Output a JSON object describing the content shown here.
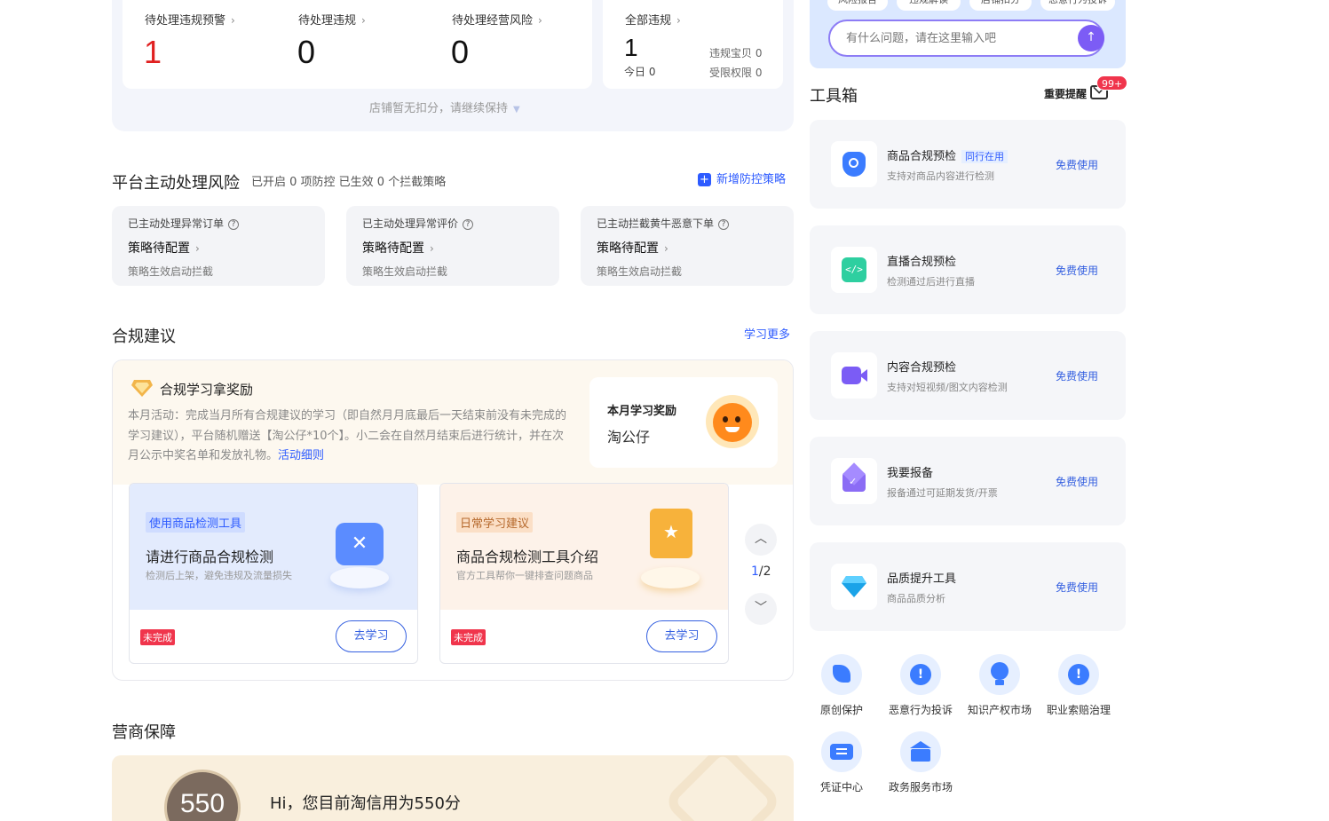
{
  "summary": {
    "items": [
      {
        "label": "待处理违规预警",
        "value": "1"
      },
      {
        "label": "待处理违规",
        "value": "0"
      },
      {
        "label": "待处理经营风险",
        "value": "0"
      }
    ],
    "all": {
      "label": "全部违规",
      "value": "1",
      "today": "今日 0",
      "baobei": "违规宝贝 0",
      "restrict": "受限权限 0"
    },
    "hint": "店铺暂无扣分，请继续保持"
  },
  "risk": {
    "title": "平台主动处理风险",
    "status": "已开启 0 项防控 已生效 0 个拦截策略",
    "add_label": "新增防控策略",
    "cards": [
      {
        "title": "已主动处理异常订单",
        "status": "策略待配置",
        "desc": "策略生效启动拦截"
      },
      {
        "title": "已主动处理异常评价",
        "status": "策略待配置",
        "desc": "策略生效启动拦截"
      },
      {
        "title": "已主动拦截黄牛恶意下单",
        "status": "策略待配置",
        "desc": "策略生效启动拦截"
      }
    ]
  },
  "compliance": {
    "title": "合规建议",
    "more": "学习更多",
    "promo_title": "合规学习拿奖励",
    "promo_text": "本月活动：完成当月所有合规建议的学习（即自然月月底最后一天结束前没有未完成的学习建议），平台随机赠送【淘公仔*10个】。小二会在自然月结束后进行统计，并在次月公示中奖名单和发放礼物。",
    "promo_link": "活动细则",
    "reward_title": "本月学习奖励",
    "reward_item": "淘公仔",
    "cards": [
      {
        "tag": "使用商品检测工具",
        "title": "请进行商品合规检测",
        "sub": "检测后上架，避免违规及流量损失",
        "badge": "未完成",
        "button": "去学习"
      },
      {
        "tag": "日常学习建议",
        "title": "商品合规检测工具介绍",
        "sub": "官方工具帮你一键排查问题商品",
        "badge": "未完成",
        "button": "去学习"
      }
    ],
    "pager_current": "1",
    "pager_total": "/2"
  },
  "guarantee": {
    "title": "营商保障",
    "score": "550",
    "text": "Hi，您目前淘信用为550分"
  },
  "ai": {
    "chips": [
      "风险报告",
      "违规解读",
      "店铺扣分",
      "恶意行为投诉"
    ],
    "placeholder": "有什么问题，请在这里输入吧"
  },
  "toolbox": {
    "title": "工具箱",
    "reminder": "重要提醒",
    "reminder_badge": "99+",
    "tools": [
      {
        "name": "商品合规预检",
        "tag": "同行在用",
        "desc": "支持对商品内容进行检测",
        "action": "免费使用"
      },
      {
        "name": "直播合规预检",
        "desc": "检测通过后进行直播",
        "action": "免费使用"
      },
      {
        "name": "内容合规预检",
        "desc": "支持对短视频/图文内容检测",
        "action": "免费使用"
      },
      {
        "name": "我要报备",
        "desc": "报备通过可延期发货/开票",
        "action": "免费使用"
      },
      {
        "name": "品质提升工具",
        "desc": "商品品质分析",
        "action": "免费使用"
      }
    ],
    "services": [
      "原创保护",
      "恶意行为投诉",
      "知识产权市场",
      "职业索赔治理",
      "凭证中心",
      "政务服务市场"
    ]
  },
  "colors": {
    "accent": "#2d5bff",
    "danger": "#f0354c",
    "warn_red": "#e02020"
  }
}
